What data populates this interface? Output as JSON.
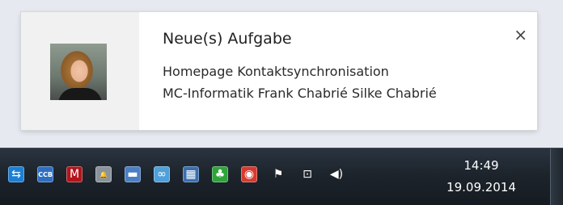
{
  "notification": {
    "title": "Neue(s) Aufgabe",
    "line1": "Homepage Kontaktsynchronisation",
    "line2": "MC-Informatik Frank Chabrié Silke Chabrié",
    "close_glyph": "×"
  },
  "taskbar": {
    "tray_icons": [
      {
        "name": "teamviewer-icon",
        "glyph": "⇆",
        "color": "#1c7fd6"
      },
      {
        "name": "ccb-icon",
        "glyph": "CCB",
        "color": "#2d6fc1"
      },
      {
        "name": "mcafee-shield-icon",
        "glyph": "M",
        "color": "#b3141b"
      },
      {
        "name": "notification-bell-icon",
        "glyph": "🔔",
        "color": "#8a939c"
      },
      {
        "name": "network-drive-icon",
        "glyph": "▬",
        "color": "#4b7fc4"
      },
      {
        "name": "sync-globe-icon",
        "glyph": "∞",
        "color": "#4fa0d8"
      },
      {
        "name": "computer-network-icon",
        "glyph": "▦",
        "color": "#3a6fae"
      },
      {
        "name": "clover-icon",
        "glyph": "♣",
        "color": "#2fa43a"
      },
      {
        "name": "media-icon",
        "glyph": "◉",
        "color": "#d63a2f"
      },
      {
        "name": "action-center-flag-icon",
        "glyph": "⚑",
        "color": "#ffffff"
      },
      {
        "name": "network-connection-icon",
        "glyph": "⊡",
        "color": "#ffffff"
      },
      {
        "name": "volume-icon",
        "glyph": "◀)",
        "color": "#ffffff"
      }
    ],
    "clock_time": "14:49",
    "clock_date": "19.09.2014"
  }
}
